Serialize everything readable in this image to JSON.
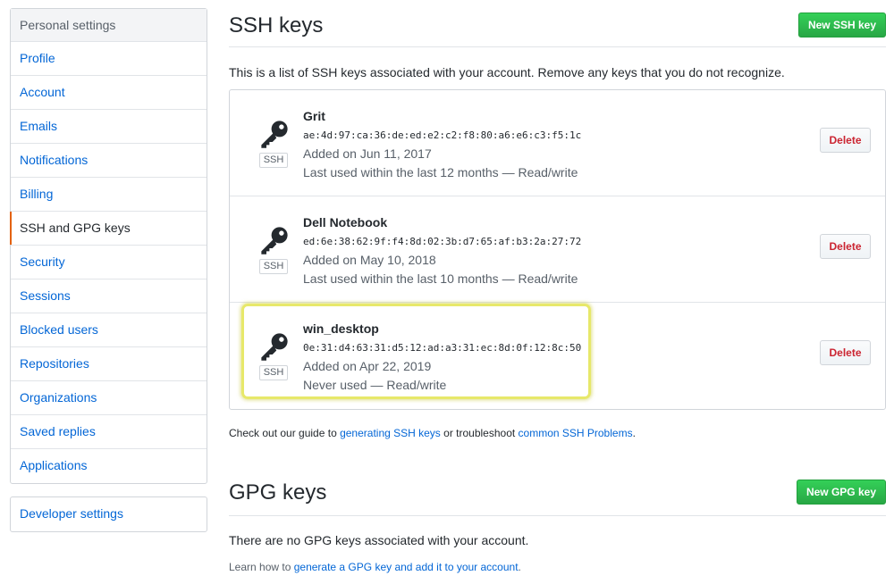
{
  "sidebar": {
    "header": "Personal settings",
    "items": [
      {
        "label": "Profile"
      },
      {
        "label": "Account"
      },
      {
        "label": "Emails"
      },
      {
        "label": "Notifications"
      },
      {
        "label": "Billing"
      },
      {
        "label": "SSH and GPG keys"
      },
      {
        "label": "Security"
      },
      {
        "label": "Sessions"
      },
      {
        "label": "Blocked users"
      },
      {
        "label": "Repositories"
      },
      {
        "label": "Organizations"
      },
      {
        "label": "Saved replies"
      },
      {
        "label": "Applications"
      }
    ],
    "selected": "SSH and GPG keys",
    "developer": "Developer settings"
  },
  "ssh": {
    "title": "SSH keys",
    "new_button": "New SSH key",
    "intro": "This is a list of SSH keys associated with your account. Remove any keys that you do not recognize.",
    "keys": [
      {
        "type": "SSH",
        "title": "Grit",
        "fingerprint": "ae:4d:97:ca:36:de:ed:e2:c2:f8:80:a6:e6:c3:f5:1c",
        "added": "Added on Jun 11, 2017",
        "used": "Last used within the last 12 months — Read/write",
        "delete": "Delete"
      },
      {
        "type": "SSH",
        "title": "Dell Notebook",
        "fingerprint": "ed:6e:38:62:9f:f4:8d:02:3b:d7:65:af:b3:2a:27:72",
        "added": "Added on May 10, 2018",
        "used": "Last used within the last 10 months — Read/write",
        "delete": "Delete"
      },
      {
        "type": "SSH",
        "title": "win_desktop",
        "fingerprint": "0e:31:d4:63:31:d5:12:ad:a3:31:ec:8d:0f:12:8c:50",
        "added": "Added on Apr 22, 2019",
        "used": "Never used — Read/write",
        "delete": "Delete"
      }
    ],
    "guide_prefix": "Check out our guide to ",
    "guide_link1": "generating SSH keys",
    "guide_middle": " or troubleshoot ",
    "guide_link2": "common SSH Problems",
    "guide_suffix": "."
  },
  "gpg": {
    "title": "GPG keys",
    "new_button": "New GPG key",
    "none": "There are no GPG keys associated with your account.",
    "learn_prefix": "Learn how to ",
    "learn_link": "generate a GPG key and add it to your account",
    "learn_suffix": "."
  },
  "colors": {
    "accent_green": "#28a745",
    "link_blue": "#0366d6",
    "danger_red": "#cb2431",
    "selected_bar": "#e36209",
    "highlight": "#e7e86a"
  },
  "icons": {
    "key": "key-icon"
  }
}
